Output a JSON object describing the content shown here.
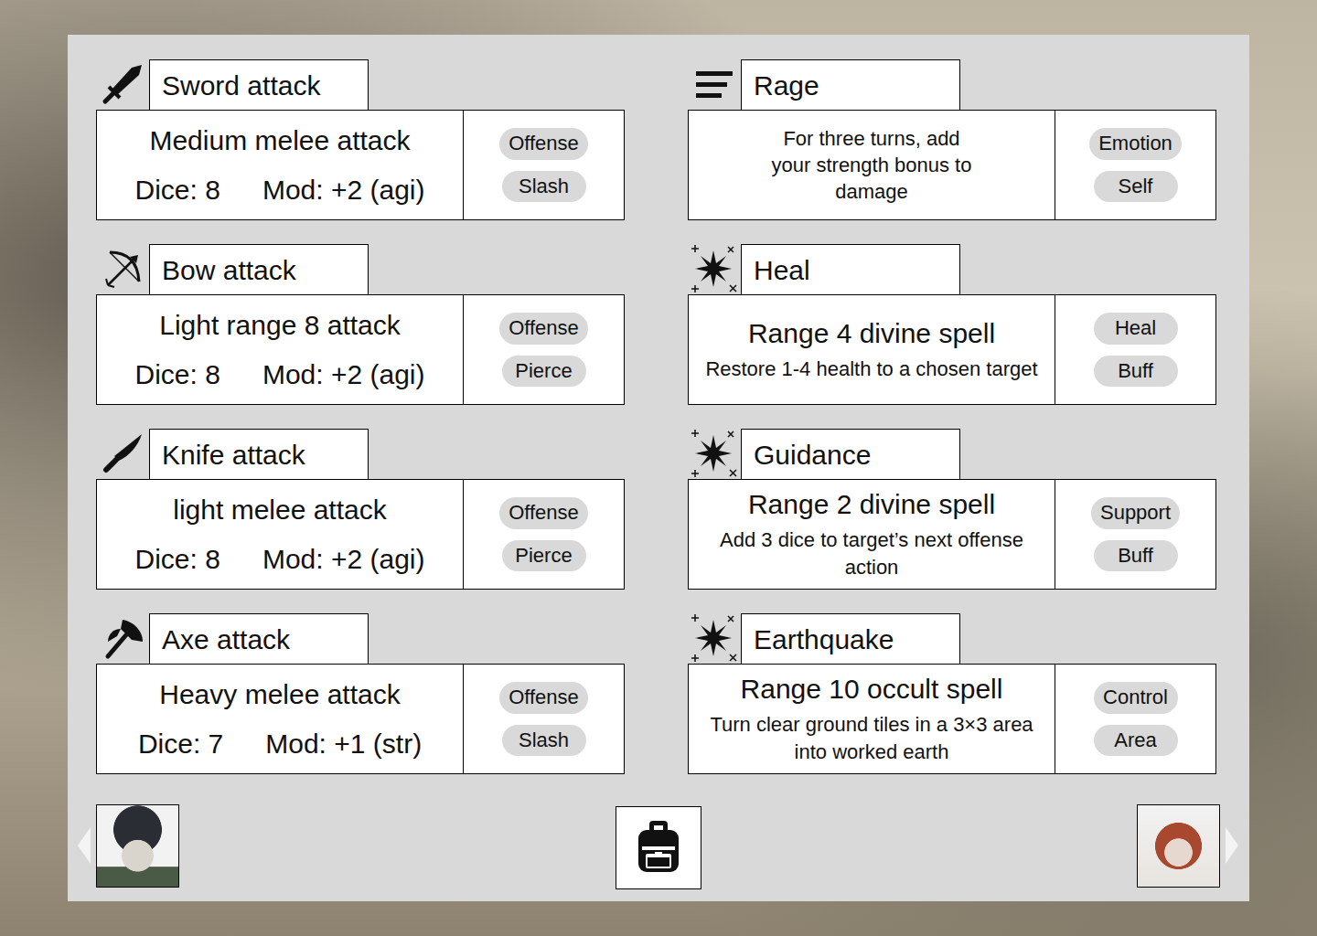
{
  "columns": [
    [
      {
        "title": "Sword attack",
        "kind": "sword",
        "heading": "Medium melee attack",
        "dice": "Dice: 8",
        "mod": "Mod: +2 (agi)",
        "tags": [
          "Offense",
          "Slash"
        ]
      },
      {
        "title": "Bow attack",
        "kind": "bow",
        "heading": "Light range 8 attack",
        "dice": "Dice: 8",
        "mod": "Mod: +2 (agi)",
        "tags": [
          "Offense",
          "Pierce"
        ]
      },
      {
        "title": "Knife attack",
        "kind": "knife",
        "heading": "light melee attack",
        "dice": "Dice: 8",
        "mod": "Mod: +2 (agi)",
        "tags": [
          "Offense",
          "Pierce"
        ]
      },
      {
        "title": "Axe attack",
        "kind": "axe",
        "heading": "Heavy melee attack",
        "dice": "Dice: 7",
        "mod": "Mod: +1 (str)",
        "tags": [
          "Offense",
          "Slash"
        ]
      }
    ],
    [
      {
        "title": "Rage",
        "kind": "emotion",
        "description": "For three turns, add your strength bonus to damage",
        "tags": [
          "Emotion",
          "Self"
        ]
      },
      {
        "title": "Heal",
        "kind": "spell",
        "heading": "Range 4 divine spell",
        "description": "Restore 1-4 health to a chosen target",
        "tags": [
          "Heal",
          "Buff"
        ]
      },
      {
        "title": "Guidance",
        "kind": "spell",
        "heading": "Range 2 divine spell",
        "description": "Add 3 dice to target’s next offense action",
        "tags": [
          "Support",
          "Buff"
        ]
      },
      {
        "title": "Earthquake",
        "kind": "spell",
        "heading": "Range 10 occult spell",
        "description": "Turn clear ground tiles in a 3×3 area into worked earth",
        "tags": [
          "Control",
          "Area"
        ]
      }
    ]
  ]
}
